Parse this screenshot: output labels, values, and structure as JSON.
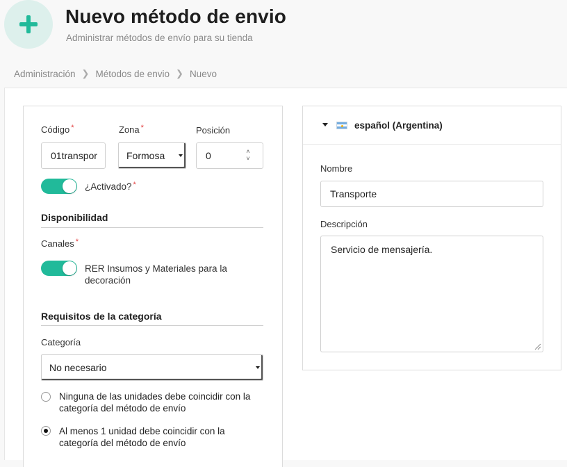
{
  "header": {
    "icon": "plus-icon",
    "accent_color": "#21ba9a",
    "title": "Nuevo método de envio",
    "subtitle": "Administrar métodos de envío para su tienda"
  },
  "breadcrumb": [
    "Administración",
    "Métodos de envio",
    "Nuevo"
  ],
  "form": {
    "code": {
      "label": "Código",
      "required_mark": "*",
      "value": "01transpor"
    },
    "zone": {
      "label": "Zona",
      "required_mark": "*",
      "value": "Formosa"
    },
    "position": {
      "label": "Posición",
      "value": "0"
    },
    "enabled": {
      "label": "¿Activado?",
      "required_mark": "*",
      "on": true
    },
    "availability": {
      "title": "Disponibilidad",
      "channels_label": "Canales",
      "required_mark": "*",
      "channel_on": true,
      "channel_name": "RER Insumos y Materiales para la decoración"
    },
    "category_requirements": {
      "title": "Requisitos de la categoría",
      "category_label": "Categoría",
      "category_value": "No necesario",
      "options": [
        {
          "label": "Ninguna de las unidades debe coincidir con la categoría del método de envío",
          "checked": false
        },
        {
          "label": "Al menos 1 unidad debe coincidir con la categoría del método de envío",
          "checked": true
        }
      ]
    }
  },
  "translation": {
    "locale": "español (Argentina)",
    "flag": "argentina-flag-icon",
    "name_label": "Nombre",
    "name_value": "Transporte",
    "description_label": "Descripción",
    "description_value": "Servicio de mensajería."
  }
}
